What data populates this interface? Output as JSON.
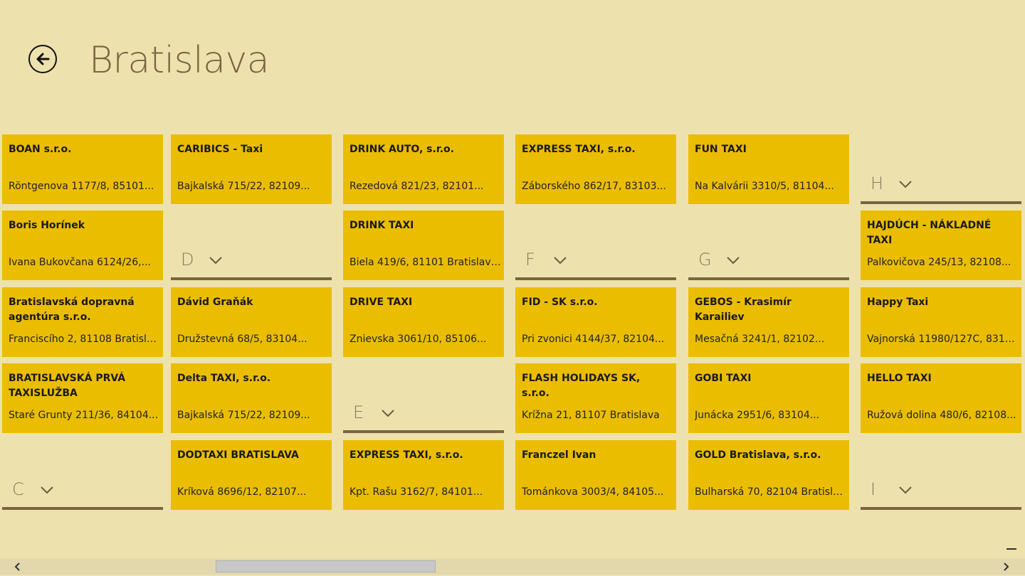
{
  "page": {
    "title": "Bratislava"
  },
  "icons": {
    "back": "back-arrow-icon",
    "chevron": "chevron-down-icon",
    "zoom": "minus-icon"
  },
  "colors": {
    "background": "#ede2ae",
    "tile": "#ebbd00",
    "header_rule": "#7b6440",
    "title": "#7a6440"
  },
  "columns": [
    [
      {
        "type": "tile",
        "name": "BOAN s.r.o.",
        "address": "Röntgenova 1177/8, 85101..."
      },
      {
        "type": "tile",
        "name": "Boris Horínek",
        "address": "Ivana Bukovčana 6124/26,..."
      },
      {
        "type": "tile",
        "name": "Bratislavská dopravná agentúra s.r.o.",
        "address": "Franciscího 2, 81108 Bratislava..."
      },
      {
        "type": "tile",
        "name": "BRATISLAVSKÁ PRVÁ TAXISLUŽBA",
        "address": "Staré Grunty 211/36, 84104..."
      },
      {
        "type": "header",
        "letter": "C"
      }
    ],
    [
      {
        "type": "tile",
        "name": "CARIBICS - Taxi",
        "address": "Bajkalská 715/22, 82109..."
      },
      {
        "type": "header",
        "letter": "D"
      },
      {
        "type": "tile",
        "name": "Dávid Graňák",
        "address": "Družstevná 68/5, 83104..."
      },
      {
        "type": "tile",
        "name": "Delta TAXI, s.r.o.",
        "address": "Bajkalská 715/22, 82109..."
      },
      {
        "type": "tile",
        "name": "DODTAXI BRATISLAVA",
        "address": "Kríková 8696/12, 82107..."
      }
    ],
    [
      {
        "type": "tile",
        "name": "DRINK AUTO, s.r.o.",
        "address": "Rezedová 821/23, 82101..."
      },
      {
        "type": "tile",
        "name": "DRINK TAXI",
        "address": "Biela 419/6, 81101 Bratislava -..."
      },
      {
        "type": "tile",
        "name": "DRIVE TAXI",
        "address": "Znievska 3061/10, 85106..."
      },
      {
        "type": "header",
        "letter": "E"
      },
      {
        "type": "tile",
        "name": "EXPRESS TAXI, s.r.o.",
        "address": "Kpt. Rašu 3162/7, 84101..."
      }
    ],
    [
      {
        "type": "tile",
        "name": "EXPRESS TAXI, s.r.o.",
        "address": "Záborského 862/17, 83103..."
      },
      {
        "type": "header",
        "letter": "F"
      },
      {
        "type": "tile",
        "name": "FID - SK s.r.o.",
        "address": "Pri zvonici 4144/37, 82104..."
      },
      {
        "type": "tile",
        "name": "FLASH HOLIDAYS SK, s.r.o.",
        "address": "Krížna 21, 81107 Bratislava"
      },
      {
        "type": "tile",
        "name": "Franczel Ivan",
        "address": "Tománkova 3003/4, 84105..."
      }
    ],
    [
      {
        "type": "tile",
        "name": "FUN TAXI",
        "address": "Na Kalvárii 3310/5, 81104..."
      },
      {
        "type": "header",
        "letter": "G"
      },
      {
        "type": "tile",
        "name": "GEBOS - Krasimír Karailiev",
        "address": "Mesačná 3241/1, 82102..."
      },
      {
        "type": "tile",
        "name": "GOBI TAXI",
        "address": "Junácka 2951/6, 83104..."
      },
      {
        "type": "tile",
        "name": "GOLD Bratislava, s.r.o.",
        "address": "Bulharská 70, 82104 Bratislava"
      }
    ],
    [
      {
        "type": "header",
        "letter": "H"
      },
      {
        "type": "tile",
        "name": "HAJDÚCH - NÁKLADNÉ TAXI",
        "address": "Palkovičova 245/13, 82108..."
      },
      {
        "type": "tile",
        "name": "Happy Taxi",
        "address": "Vajnorská 11980/127C, 83104..."
      },
      {
        "type": "tile",
        "name": "HELLO TAXI",
        "address": "Ružová dolina 480/6, 82108..."
      },
      {
        "type": "header",
        "letter": "I"
      }
    ]
  ]
}
